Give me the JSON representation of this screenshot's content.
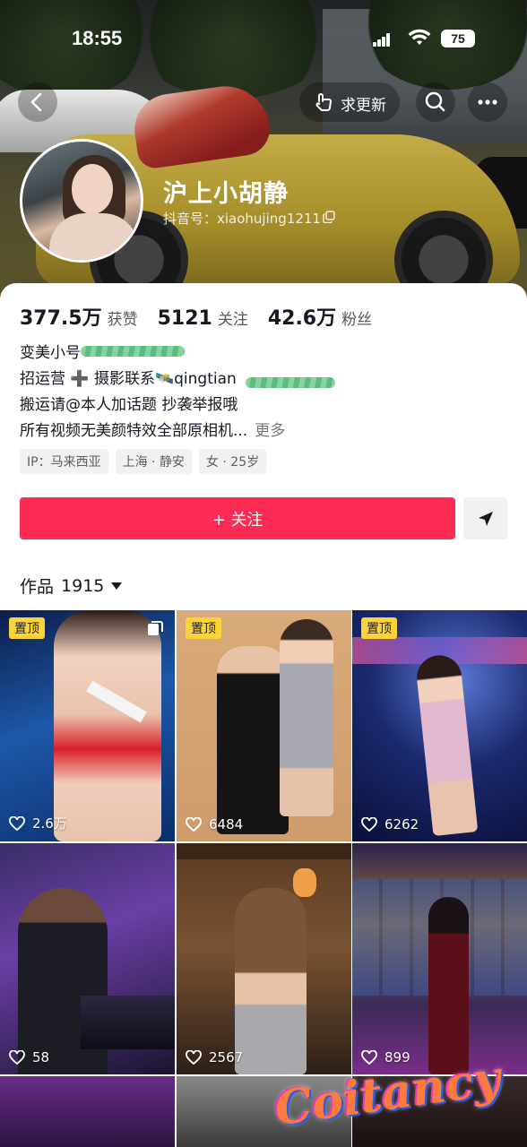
{
  "status_bar": {
    "time": "18:55",
    "battery": "75"
  },
  "nav": {
    "update_label": "求更新"
  },
  "profile": {
    "display_name": "沪上小胡静",
    "douyin_id": "抖音号：xiaohujing1211"
  },
  "stats": [
    {
      "value": "377.5万",
      "label": "获赞"
    },
    {
      "value": "5121",
      "label": "关注"
    },
    {
      "value": "42.6万",
      "label": "粉丝"
    }
  ],
  "bio": {
    "line1": "变美小号",
    "line2": "招运营 ➕ 摄影联系🛰️qingtian",
    "line3": "搬运请@本人加话题 抄袭举报哦",
    "line4": "所有视频无美颜特效全部原相机...",
    "more": "更多"
  },
  "tags": [
    "IP：马来西亚",
    "上海 · 静安",
    "女 · 25岁"
  ],
  "follow_label": "+ 关注",
  "works": {
    "label": "作品",
    "count": "1915"
  },
  "videos": [
    {
      "pinned": "置顶",
      "likes": "2.6万"
    },
    {
      "pinned": "置顶",
      "likes": "6484"
    },
    {
      "pinned": "置顶",
      "likes": "6262"
    },
    {
      "pinned": "",
      "likes": "58"
    },
    {
      "pinned": "",
      "likes": "2567"
    },
    {
      "pinned": "",
      "likes": "899"
    }
  ],
  "watermark": "Coitancy",
  "colors": {
    "accent": "#fe2c55",
    "pin_badge": "#fdd33a"
  }
}
